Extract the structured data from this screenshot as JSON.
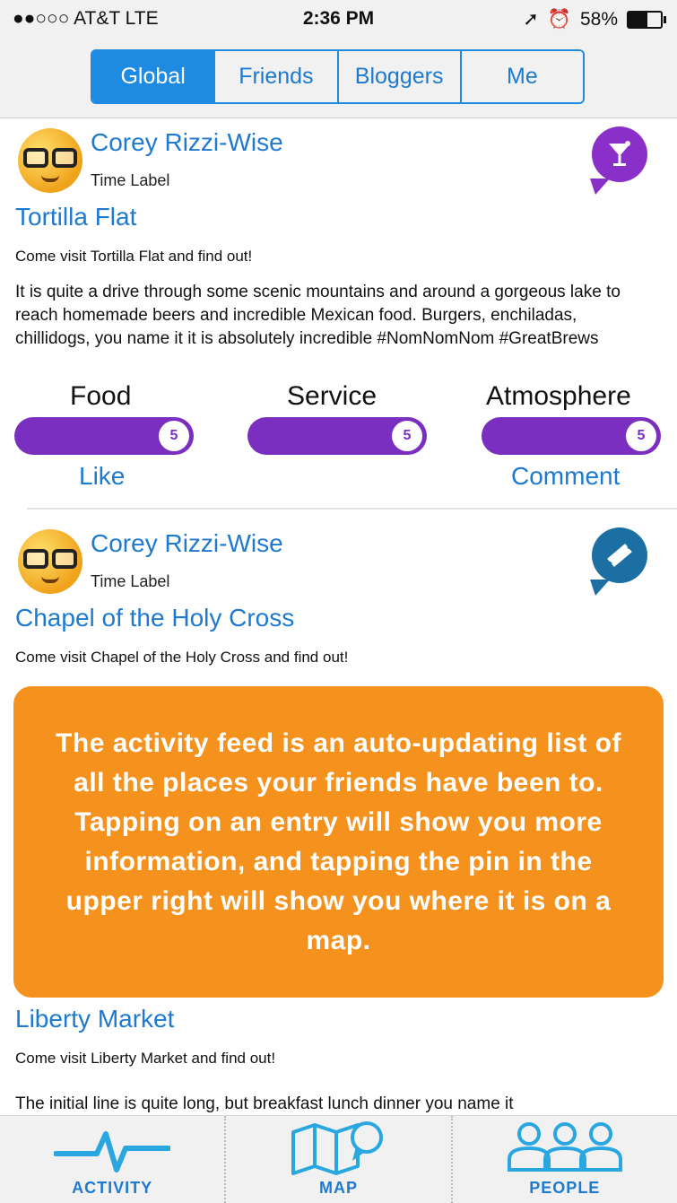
{
  "status_bar": {
    "carrier": "●●○○○ AT&T  LTE",
    "time": "2:36 PM",
    "battery": "58%",
    "battery_level": 0.58
  },
  "header": {
    "tabs": [
      {
        "label": "Global",
        "active": true
      },
      {
        "label": "Friends",
        "active": false
      },
      {
        "label": "Bloggers",
        "active": false
      },
      {
        "label": "Me",
        "active": false
      }
    ]
  },
  "feed": {
    "entries": [
      {
        "user": "Corey Rizzi-Wise",
        "time_label": "Time Label",
        "place": "Tortilla Flat",
        "subline": "Come visit Tortilla Flat and find out!",
        "description": "It is quite a drive through some scenic mountains and around a gorgeous lake to reach homemade beers and incredible Mexican food. Burgers, enchiladas, chillidogs, you name it it is absolutely incredible #NomNomNom #GreatBrews",
        "category_icon": "cocktail-icon",
        "category_color": "#8b2fc9",
        "ratings": [
          {
            "label": "Food",
            "value": "5"
          },
          {
            "label": "Service",
            "value": "5"
          },
          {
            "label": "Atmosphere",
            "value": "5"
          }
        ],
        "like_label": "Like",
        "comment_label": "Comment"
      },
      {
        "user": "Corey Rizzi-Wise",
        "time_label": "Time Label",
        "place": "Chapel of the Holy Cross",
        "subline": "Come visit Chapel of the Holy Cross and find out!",
        "category_icon": "ticket-icon",
        "category_color": "#1c6fa3"
      },
      {
        "place": "Liberty Market",
        "subline": "Come visit Liberty Market and find out!",
        "description": "The initial line is quite long, but breakfast lunch dinner you name it"
      }
    ]
  },
  "overlay": {
    "text": "The activity feed is an auto-updating list of all the places your friends have been to. Tapping on an entry will show you more information, and tapping the pin in the upper right will show you where it is on a map."
  },
  "tab_bar": {
    "tabs": [
      {
        "label": "ACTIVITY",
        "icon": "activity-icon"
      },
      {
        "label": "MAP",
        "icon": "map-icon"
      },
      {
        "label": "PEOPLE",
        "icon": "people-icon"
      }
    ]
  },
  "colors": {
    "accent": "#1e8ae2",
    "rating_purple": "#7a2fc0",
    "overlay_orange": "#f5921e"
  }
}
